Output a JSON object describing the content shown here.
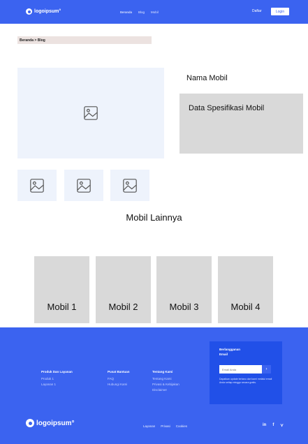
{
  "header": {
    "logo_text": "logoipsum°",
    "nav": [
      "Beranda",
      "Blog",
      "Mobil"
    ],
    "daftar": "Daftar",
    "login": "Login"
  },
  "breadcrumb": "Beranda > Blog",
  "detail": {
    "car_name": "Nama Mobil",
    "spec": "Data Spesifikasi Mobil"
  },
  "others": {
    "title": "Mobil Lainnya",
    "cards": [
      "Mobil 1",
      "Mobil 2",
      "Mobil 3",
      "Mobil 4"
    ]
  },
  "footer": {
    "col1": {
      "heading": "Produk Dan Layanan",
      "links": [
        "Produk 1",
        "Layanan 1"
      ]
    },
    "col2": {
      "heading": "Pusat Bantuan",
      "links": [
        "FAQ",
        "Hubungi Kami"
      ]
    },
    "col3": {
      "heading": "Tentang Kami",
      "links": [
        "Tentang Kami",
        "Privasi & Kebijakan",
        "Disclaimer"
      ]
    },
    "newsletter": {
      "heading": "Berlangganan Email",
      "placeholder": "Email Anda",
      "button": "›",
      "desc": "Dapatkan update terbaru dari kami melalui email Anda setiap minggu secara gratis."
    },
    "logo_text": "logoipsum°",
    "links": [
      "Layanan",
      "Privasi",
      "Cookies"
    ],
    "social": [
      "in",
      "f",
      "⋎"
    ]
  },
  "colors": {
    "primary": "#3b63f0",
    "placeholder_bg": "#eef3fc",
    "card_bg": "#d9d9d9"
  }
}
